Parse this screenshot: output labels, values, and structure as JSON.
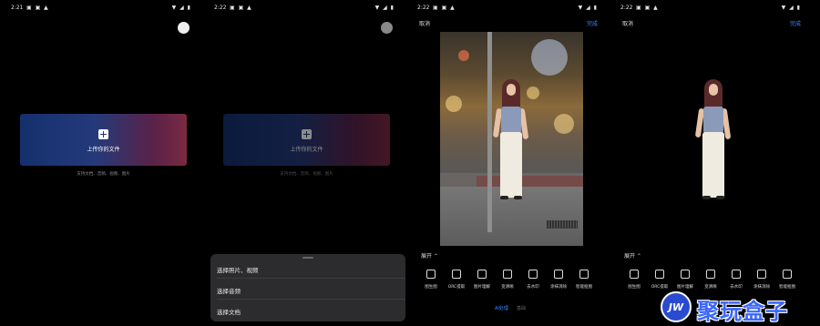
{
  "panels": [
    {
      "time": "2:21",
      "upload_label": "上传你的文件",
      "hint": "支持文档、音频、视频、图片"
    },
    {
      "time": "2:22",
      "upload_label": "上传你的文件",
      "hint": "支持文档、音频、视频、图片",
      "sheet_items": [
        "选择照片、视频",
        "选择音频",
        "选择文档"
      ]
    },
    {
      "time": "2:22",
      "cancel": "取消",
      "done": "完成",
      "expand": "展开 ⌃",
      "tabs": [
        "AI处理",
        "基础"
      ]
    },
    {
      "time": "2:22",
      "cancel": "取消",
      "done": "完成",
      "expand": "展开 ⌃"
    }
  ],
  "tools": [
    "图生图",
    "ORC提取",
    "图片理解",
    "变清晰",
    "去水印",
    "涂抹消除",
    "智能抠图"
  ],
  "watermark": {
    "logo": "JW",
    "text": "聚玩盒子"
  },
  "colors": {
    "accent": "#3c8cff",
    "upload_gradient_start": "#15306e",
    "upload_gradient_end": "#7a2a42"
  }
}
